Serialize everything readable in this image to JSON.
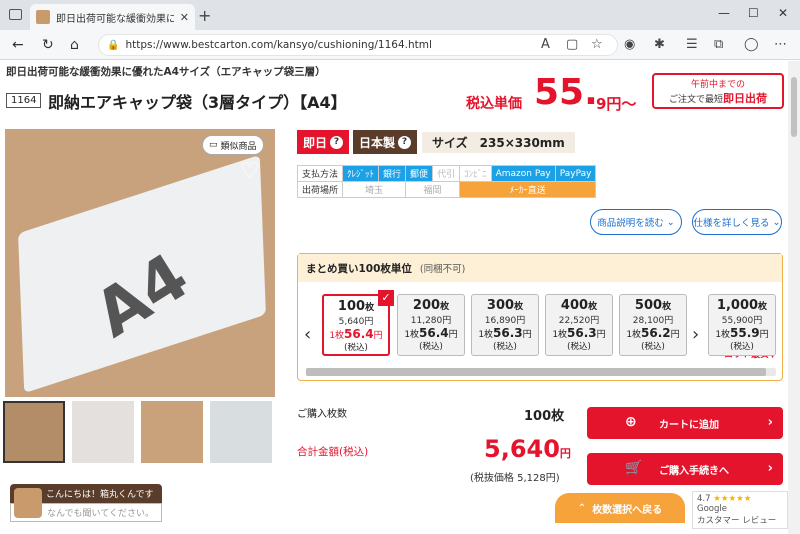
{
  "browser": {
    "tab_title": "即日出荷可能な緩衝効果に優れた",
    "url": "https://www.bestcarton.com/kansyo/cushioning/1164.html"
  },
  "product": {
    "subtitle": "即日出荷可能な緩衝効果に優れたA4サイズ（エアキャップ袋三層）",
    "code": "1164",
    "title": "即納エアキャップ袋（3層タイプ）【A4】",
    "price_label": "税込単価",
    "price_int": "55.",
    "price_dec": "9円〜",
    "ship_line1": "午前中までの",
    "ship_line2_prefix": "ご注文で最短",
    "ship_line2_em": "即日出荷"
  },
  "image": {
    "main_text": "A4",
    "similar_label": "類似商品"
  },
  "badges": {
    "sameday": "即日",
    "japan": "日本製",
    "size": "サイズ　235×330mm"
  },
  "payment": {
    "pay_label": "支払方法",
    "ship_label": "出荷場所",
    "methods": [
      "ｸﾚｼﾞｯﾄ",
      "銀行",
      "郵便",
      "代引",
      "ｺﾝﾋﾞﾆ",
      "Amazon Pay",
      "PayPay"
    ],
    "places": [
      "埼玉",
      "福岡",
      "ﾒｰｶｰ直送"
    ]
  },
  "links": {
    "desc": "商品説明を読む",
    "spec": "仕様を詳しく見る"
  },
  "bulk": {
    "heading": "まとめ買い100枚単位",
    "note": "(同梱不可)",
    "lot_note": "ロット最安▼",
    "cards": [
      {
        "qty": "100",
        "unit_suffix": "枚",
        "total": "5,640円",
        "per_prefix": "1枚",
        "per": "56.4",
        "yen": "円",
        "tax": "(税込)"
      },
      {
        "qty": "200",
        "unit_suffix": "枚",
        "total": "11,280円",
        "per_prefix": "1枚",
        "per": "56.4",
        "yen": "円",
        "tax": "(税込)"
      },
      {
        "qty": "300",
        "unit_suffix": "枚",
        "total": "16,890円",
        "per_prefix": "1枚",
        "per": "56.3",
        "yen": "円",
        "tax": "(税込)"
      },
      {
        "qty": "400",
        "unit_suffix": "枚",
        "total": "22,520円",
        "per_prefix": "1枚",
        "per": "56.3",
        "yen": "円",
        "tax": "(税込)"
      },
      {
        "qty": "500",
        "unit_suffix": "枚",
        "total": "28,100円",
        "per_prefix": "1枚",
        "per": "56.2",
        "yen": "円",
        "tax": "(税込)"
      },
      {
        "qty": "1,000",
        "unit_suffix": "枚",
        "total": "55,900円",
        "per_prefix": "1枚",
        "per": "55.9",
        "yen": "円",
        "tax": "(税込)"
      }
    ]
  },
  "order": {
    "qty_label": "ご購入枚数",
    "qty_value": "100枚",
    "total_label": "合計金額(税込)",
    "total_value": "5,640",
    "total_unit": "円",
    "ex_tax": "(税抜価格 5,128円)",
    "cart_button": "カートに追加",
    "checkout_button": "ご購入手続きへ",
    "back_button": "枚数選択へ戻る"
  },
  "google": {
    "rating": "4.7",
    "brand": "Google",
    "reviews": "カスタマー レビュー"
  },
  "chat": {
    "greeting": "こんにちは！箱丸くんです",
    "placeholder": "なんでも聞いてください。"
  },
  "colors": {
    "accent_red": "#e4142d",
    "accent_orange": "#f7a33c",
    "pay_blue": "#1da1e6",
    "brown": "#5a3c2a"
  }
}
